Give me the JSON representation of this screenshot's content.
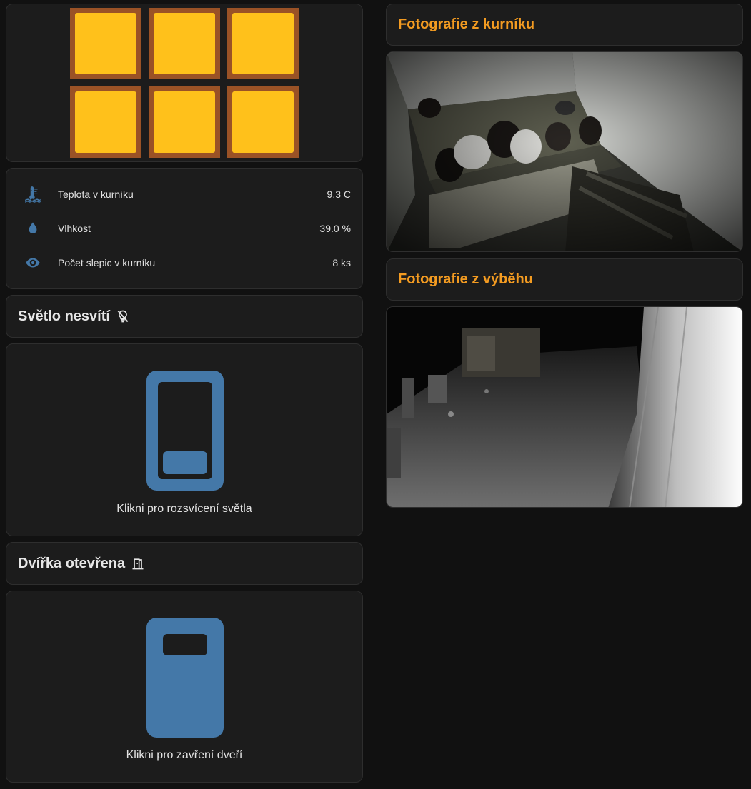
{
  "colors": {
    "egg_fill": "#ffc11b",
    "egg_frame": "#9a5226",
    "icon_blue": "#4478a8",
    "accent_orange": "#f39b21"
  },
  "sensors": [
    {
      "label": "Teplota v kurníku",
      "value": "9.3 C",
      "icon": "thermometer-water-icon"
    },
    {
      "label": "Vlhkost",
      "value": "39.0 %",
      "icon": "water-drop-icon"
    },
    {
      "label": "Počet slepic v kurníku",
      "value": "8 ks",
      "icon": "eye-icon"
    }
  ],
  "light": {
    "status_title": "Světlo nesvítí",
    "status_icon": "lightbulb-off-icon",
    "button_caption": "Klikni pro rozsvícení světla",
    "button_icon": "light-switch-off-icon"
  },
  "door": {
    "status_title": "Dvířka otevřena",
    "status_icon": "door-open-icon",
    "button_caption": "Klikni pro zavření dveří",
    "button_icon": "door-shutter-icon"
  },
  "cameras": {
    "coop_title": "Fotografie z kurníku",
    "run_title": "Fotografie z výběhu"
  }
}
